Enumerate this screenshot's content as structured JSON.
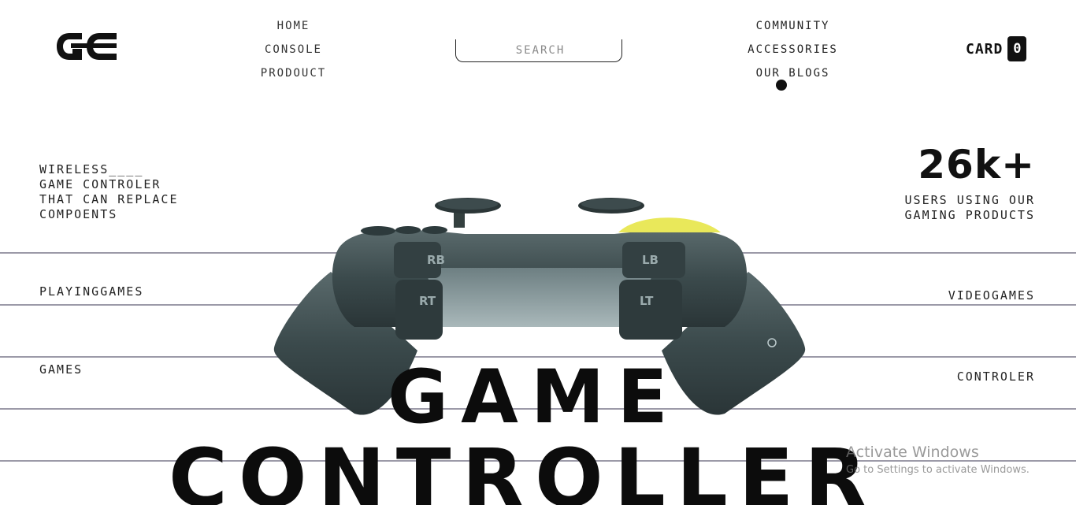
{
  "brand": {
    "logo_text": "GC"
  },
  "nav": {
    "left": [
      "HOME",
      "CONSOLE",
      "PRODOUCT"
    ],
    "right": [
      "COMMUNITY",
      "ACCESSORIES",
      "OUR BLOGS"
    ]
  },
  "search": {
    "placeholder": "SEARCH"
  },
  "cart": {
    "label": "CARD",
    "count": "0"
  },
  "hero": {
    "tagline": [
      "WIRELESS____",
      "GAME CONTROLER",
      "THAT CAN REPLACE",
      "COMPOENTS"
    ],
    "stat_value": "26k+",
    "stat_label": [
      "USERS USING OUR",
      "GAMING PRODUCTS"
    ],
    "categories_left": [
      "PLAYINGGAMES",
      "GAMES"
    ],
    "categories_right": [
      "VIDEOGAMES",
      "CONTROLER"
    ],
    "headline_line1": "GAME",
    "headline_line2": "CONTROLLER"
  },
  "controller_labels": {
    "rb": "RB",
    "rt": "RT",
    "lb": "LB",
    "lt": "LT"
  },
  "colors": {
    "accent": "#e9e85a",
    "controller_body": "#3b4a4c",
    "rule": "#9c9aa8"
  },
  "watermark": {
    "title": "Activate Windows",
    "subtitle": "Go to Settings to activate Windows."
  }
}
